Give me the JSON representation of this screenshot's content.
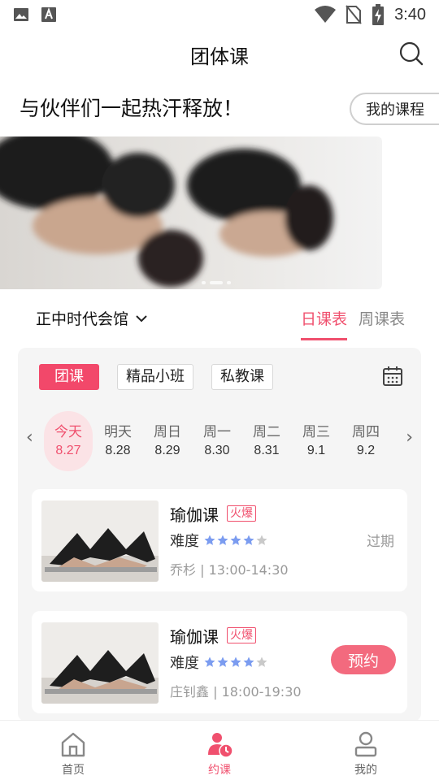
{
  "status_bar": {
    "time": "3:40"
  },
  "header": {
    "title": "团体课"
  },
  "slogan": {
    "text": "与伙伴们一起热汗释放！",
    "my_courses_label": "我的课程"
  },
  "banner": {
    "slide_count": 3,
    "active_slide": 2
  },
  "gym": {
    "name": "正中时代会馆"
  },
  "view_tabs": [
    {
      "label": "日课表",
      "active": true
    },
    {
      "label": "周课表",
      "active": false
    }
  ],
  "type_tabs": [
    {
      "label": "团课",
      "active": true
    },
    {
      "label": "精品小班",
      "active": false
    },
    {
      "label": "私教课",
      "active": false
    }
  ],
  "days": [
    {
      "weekday": "今天",
      "date": "8.27",
      "active": true
    },
    {
      "weekday": "明天",
      "date": "8.28",
      "active": false
    },
    {
      "weekday": "周日",
      "date": "8.29",
      "active": false
    },
    {
      "weekday": "周一",
      "date": "8.30",
      "active": false
    },
    {
      "weekday": "周二",
      "date": "8.31",
      "active": false
    },
    {
      "weekday": "周三",
      "date": "9.1",
      "active": false
    },
    {
      "weekday": "周四",
      "date": "9.2",
      "active": false
    }
  ],
  "courses": [
    {
      "name": "瑜伽课",
      "badge": "火爆",
      "difficulty_label": "难度",
      "difficulty": 4,
      "difficulty_max": 5,
      "meta": "乔杉 | 13:00-14:30",
      "status": "过期"
    },
    {
      "name": "瑜伽课",
      "badge": "火爆",
      "difficulty_label": "难度",
      "difficulty": 4,
      "difficulty_max": 5,
      "meta": "庄钊鑫 | 18:00-19:30",
      "action": "预约"
    }
  ],
  "bottom_nav": [
    {
      "label": "首页",
      "icon": "home-icon",
      "active": false
    },
    {
      "label": "约课",
      "icon": "book-class-icon",
      "active": true
    },
    {
      "label": "我的",
      "icon": "profile-icon",
      "active": false
    }
  ],
  "colors": {
    "accent": "#f0506e",
    "accent_light": "#fbe3e6",
    "star": "#7b9cf0",
    "panel_bg": "#f5f5f5"
  }
}
